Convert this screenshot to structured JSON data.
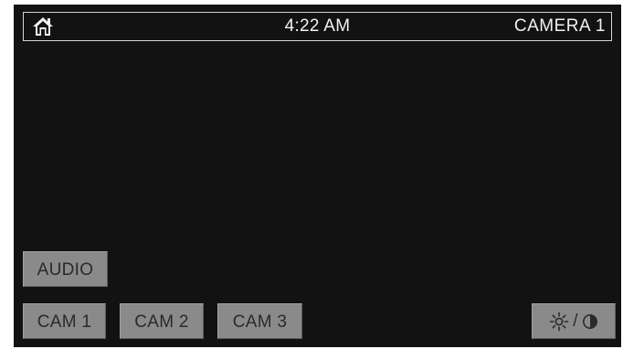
{
  "status_bar": {
    "time": "4:22 AM",
    "camera_title": "CAMERA 1",
    "home_icon": "home-icon"
  },
  "controls": {
    "audio_label": "AUDIO",
    "cameras": [
      "CAM 1",
      "CAM 2",
      "CAM 3"
    ],
    "brightness_contrast": {
      "separator": "/",
      "icons": [
        "sun-icon",
        "contrast-icon"
      ]
    }
  },
  "colors": {
    "background": "#121212",
    "status_text": "#f2f2f2",
    "button_bg": "#8a8a8a",
    "button_text": "#2a2a2a",
    "frame_border": "#d4d4d4"
  }
}
